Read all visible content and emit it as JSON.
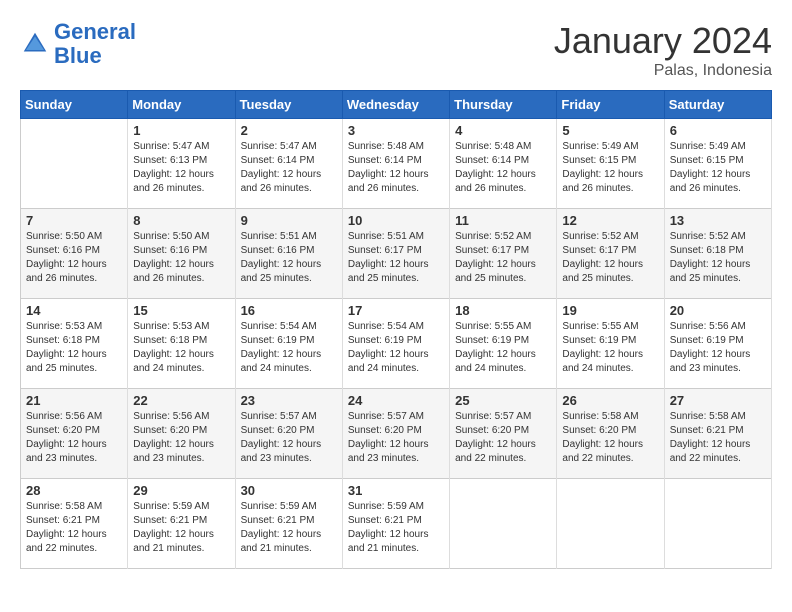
{
  "header": {
    "logo_line1": "General",
    "logo_line2": "Blue",
    "month": "January 2024",
    "location": "Palas, Indonesia"
  },
  "weekdays": [
    "Sunday",
    "Monday",
    "Tuesday",
    "Wednesday",
    "Thursday",
    "Friday",
    "Saturday"
  ],
  "weeks": [
    [
      {
        "day": "",
        "sunrise": "",
        "sunset": "",
        "daylight": ""
      },
      {
        "day": "1",
        "sunrise": "Sunrise: 5:47 AM",
        "sunset": "Sunset: 6:13 PM",
        "daylight": "Daylight: 12 hours and 26 minutes."
      },
      {
        "day": "2",
        "sunrise": "Sunrise: 5:47 AM",
        "sunset": "Sunset: 6:14 PM",
        "daylight": "Daylight: 12 hours and 26 minutes."
      },
      {
        "day": "3",
        "sunrise": "Sunrise: 5:48 AM",
        "sunset": "Sunset: 6:14 PM",
        "daylight": "Daylight: 12 hours and 26 minutes."
      },
      {
        "day": "4",
        "sunrise": "Sunrise: 5:48 AM",
        "sunset": "Sunset: 6:14 PM",
        "daylight": "Daylight: 12 hours and 26 minutes."
      },
      {
        "day": "5",
        "sunrise": "Sunrise: 5:49 AM",
        "sunset": "Sunset: 6:15 PM",
        "daylight": "Daylight: 12 hours and 26 minutes."
      },
      {
        "day": "6",
        "sunrise": "Sunrise: 5:49 AM",
        "sunset": "Sunset: 6:15 PM",
        "daylight": "Daylight: 12 hours and 26 minutes."
      }
    ],
    [
      {
        "day": "7",
        "sunrise": "Sunrise: 5:50 AM",
        "sunset": "Sunset: 6:16 PM",
        "daylight": "Daylight: 12 hours and 26 minutes."
      },
      {
        "day": "8",
        "sunrise": "Sunrise: 5:50 AM",
        "sunset": "Sunset: 6:16 PM",
        "daylight": "Daylight: 12 hours and 26 minutes."
      },
      {
        "day": "9",
        "sunrise": "Sunrise: 5:51 AM",
        "sunset": "Sunset: 6:16 PM",
        "daylight": "Daylight: 12 hours and 25 minutes."
      },
      {
        "day": "10",
        "sunrise": "Sunrise: 5:51 AM",
        "sunset": "Sunset: 6:17 PM",
        "daylight": "Daylight: 12 hours and 25 minutes."
      },
      {
        "day": "11",
        "sunrise": "Sunrise: 5:52 AM",
        "sunset": "Sunset: 6:17 PM",
        "daylight": "Daylight: 12 hours and 25 minutes."
      },
      {
        "day": "12",
        "sunrise": "Sunrise: 5:52 AM",
        "sunset": "Sunset: 6:17 PM",
        "daylight": "Daylight: 12 hours and 25 minutes."
      },
      {
        "day": "13",
        "sunrise": "Sunrise: 5:52 AM",
        "sunset": "Sunset: 6:18 PM",
        "daylight": "Daylight: 12 hours and 25 minutes."
      }
    ],
    [
      {
        "day": "14",
        "sunrise": "Sunrise: 5:53 AM",
        "sunset": "Sunset: 6:18 PM",
        "daylight": "Daylight: 12 hours and 25 minutes."
      },
      {
        "day": "15",
        "sunrise": "Sunrise: 5:53 AM",
        "sunset": "Sunset: 6:18 PM",
        "daylight": "Daylight: 12 hours and 24 minutes."
      },
      {
        "day": "16",
        "sunrise": "Sunrise: 5:54 AM",
        "sunset": "Sunset: 6:19 PM",
        "daylight": "Daylight: 12 hours and 24 minutes."
      },
      {
        "day": "17",
        "sunrise": "Sunrise: 5:54 AM",
        "sunset": "Sunset: 6:19 PM",
        "daylight": "Daylight: 12 hours and 24 minutes."
      },
      {
        "day": "18",
        "sunrise": "Sunrise: 5:55 AM",
        "sunset": "Sunset: 6:19 PM",
        "daylight": "Daylight: 12 hours and 24 minutes."
      },
      {
        "day": "19",
        "sunrise": "Sunrise: 5:55 AM",
        "sunset": "Sunset: 6:19 PM",
        "daylight": "Daylight: 12 hours and 24 minutes."
      },
      {
        "day": "20",
        "sunrise": "Sunrise: 5:56 AM",
        "sunset": "Sunset: 6:19 PM",
        "daylight": "Daylight: 12 hours and 23 minutes."
      }
    ],
    [
      {
        "day": "21",
        "sunrise": "Sunrise: 5:56 AM",
        "sunset": "Sunset: 6:20 PM",
        "daylight": "Daylight: 12 hours and 23 minutes."
      },
      {
        "day": "22",
        "sunrise": "Sunrise: 5:56 AM",
        "sunset": "Sunset: 6:20 PM",
        "daylight": "Daylight: 12 hours and 23 minutes."
      },
      {
        "day": "23",
        "sunrise": "Sunrise: 5:57 AM",
        "sunset": "Sunset: 6:20 PM",
        "daylight": "Daylight: 12 hours and 23 minutes."
      },
      {
        "day": "24",
        "sunrise": "Sunrise: 5:57 AM",
        "sunset": "Sunset: 6:20 PM",
        "daylight": "Daylight: 12 hours and 23 minutes."
      },
      {
        "day": "25",
        "sunrise": "Sunrise: 5:57 AM",
        "sunset": "Sunset: 6:20 PM",
        "daylight": "Daylight: 12 hours and 22 minutes."
      },
      {
        "day": "26",
        "sunrise": "Sunrise: 5:58 AM",
        "sunset": "Sunset: 6:20 PM",
        "daylight": "Daylight: 12 hours and 22 minutes."
      },
      {
        "day": "27",
        "sunrise": "Sunrise: 5:58 AM",
        "sunset": "Sunset: 6:21 PM",
        "daylight": "Daylight: 12 hours and 22 minutes."
      }
    ],
    [
      {
        "day": "28",
        "sunrise": "Sunrise: 5:58 AM",
        "sunset": "Sunset: 6:21 PM",
        "daylight": "Daylight: 12 hours and 22 minutes."
      },
      {
        "day": "29",
        "sunrise": "Sunrise: 5:59 AM",
        "sunset": "Sunset: 6:21 PM",
        "daylight": "Daylight: 12 hours and 21 minutes."
      },
      {
        "day": "30",
        "sunrise": "Sunrise: 5:59 AM",
        "sunset": "Sunset: 6:21 PM",
        "daylight": "Daylight: 12 hours and 21 minutes."
      },
      {
        "day": "31",
        "sunrise": "Sunrise: 5:59 AM",
        "sunset": "Sunset: 6:21 PM",
        "daylight": "Daylight: 12 hours and 21 minutes."
      },
      {
        "day": "",
        "sunrise": "",
        "sunset": "",
        "daylight": ""
      },
      {
        "day": "",
        "sunrise": "",
        "sunset": "",
        "daylight": ""
      },
      {
        "day": "",
        "sunrise": "",
        "sunset": "",
        "daylight": ""
      }
    ]
  ]
}
